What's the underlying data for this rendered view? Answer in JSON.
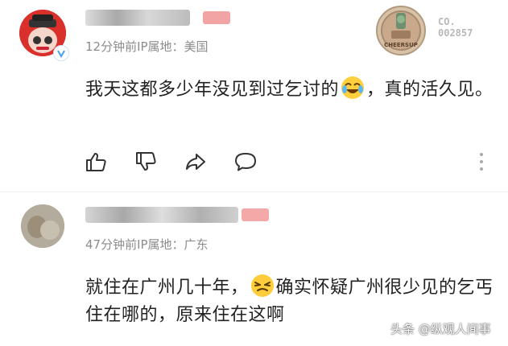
{
  "comments": [
    {
      "meta": "12分钟前IP属地：美国",
      "text_before": "我天这都多少年没见到过乞讨的",
      "text_after": "，真的活久见。",
      "emoji": "laughing-tears-emoji",
      "badge": {
        "label": "CHEERS UP",
        "code": "CO.\n002857"
      }
    },
    {
      "meta": "47分钟前IP属地：广东",
      "text_before": "就住在广州几十年，",
      "text_after": "确实怀疑广州很少见的乞丐住在哪的，原来住在这啊",
      "emoji": "squinting-face-emoji"
    }
  ],
  "actions": [
    "like-icon",
    "dislike-icon",
    "share-icon",
    "comment-icon",
    "more-icon"
  ],
  "watermark": "头条 @纵观人间事",
  "colors": {
    "accent_red": "#e8585b",
    "meta_gray": "#8c8c8c"
  }
}
